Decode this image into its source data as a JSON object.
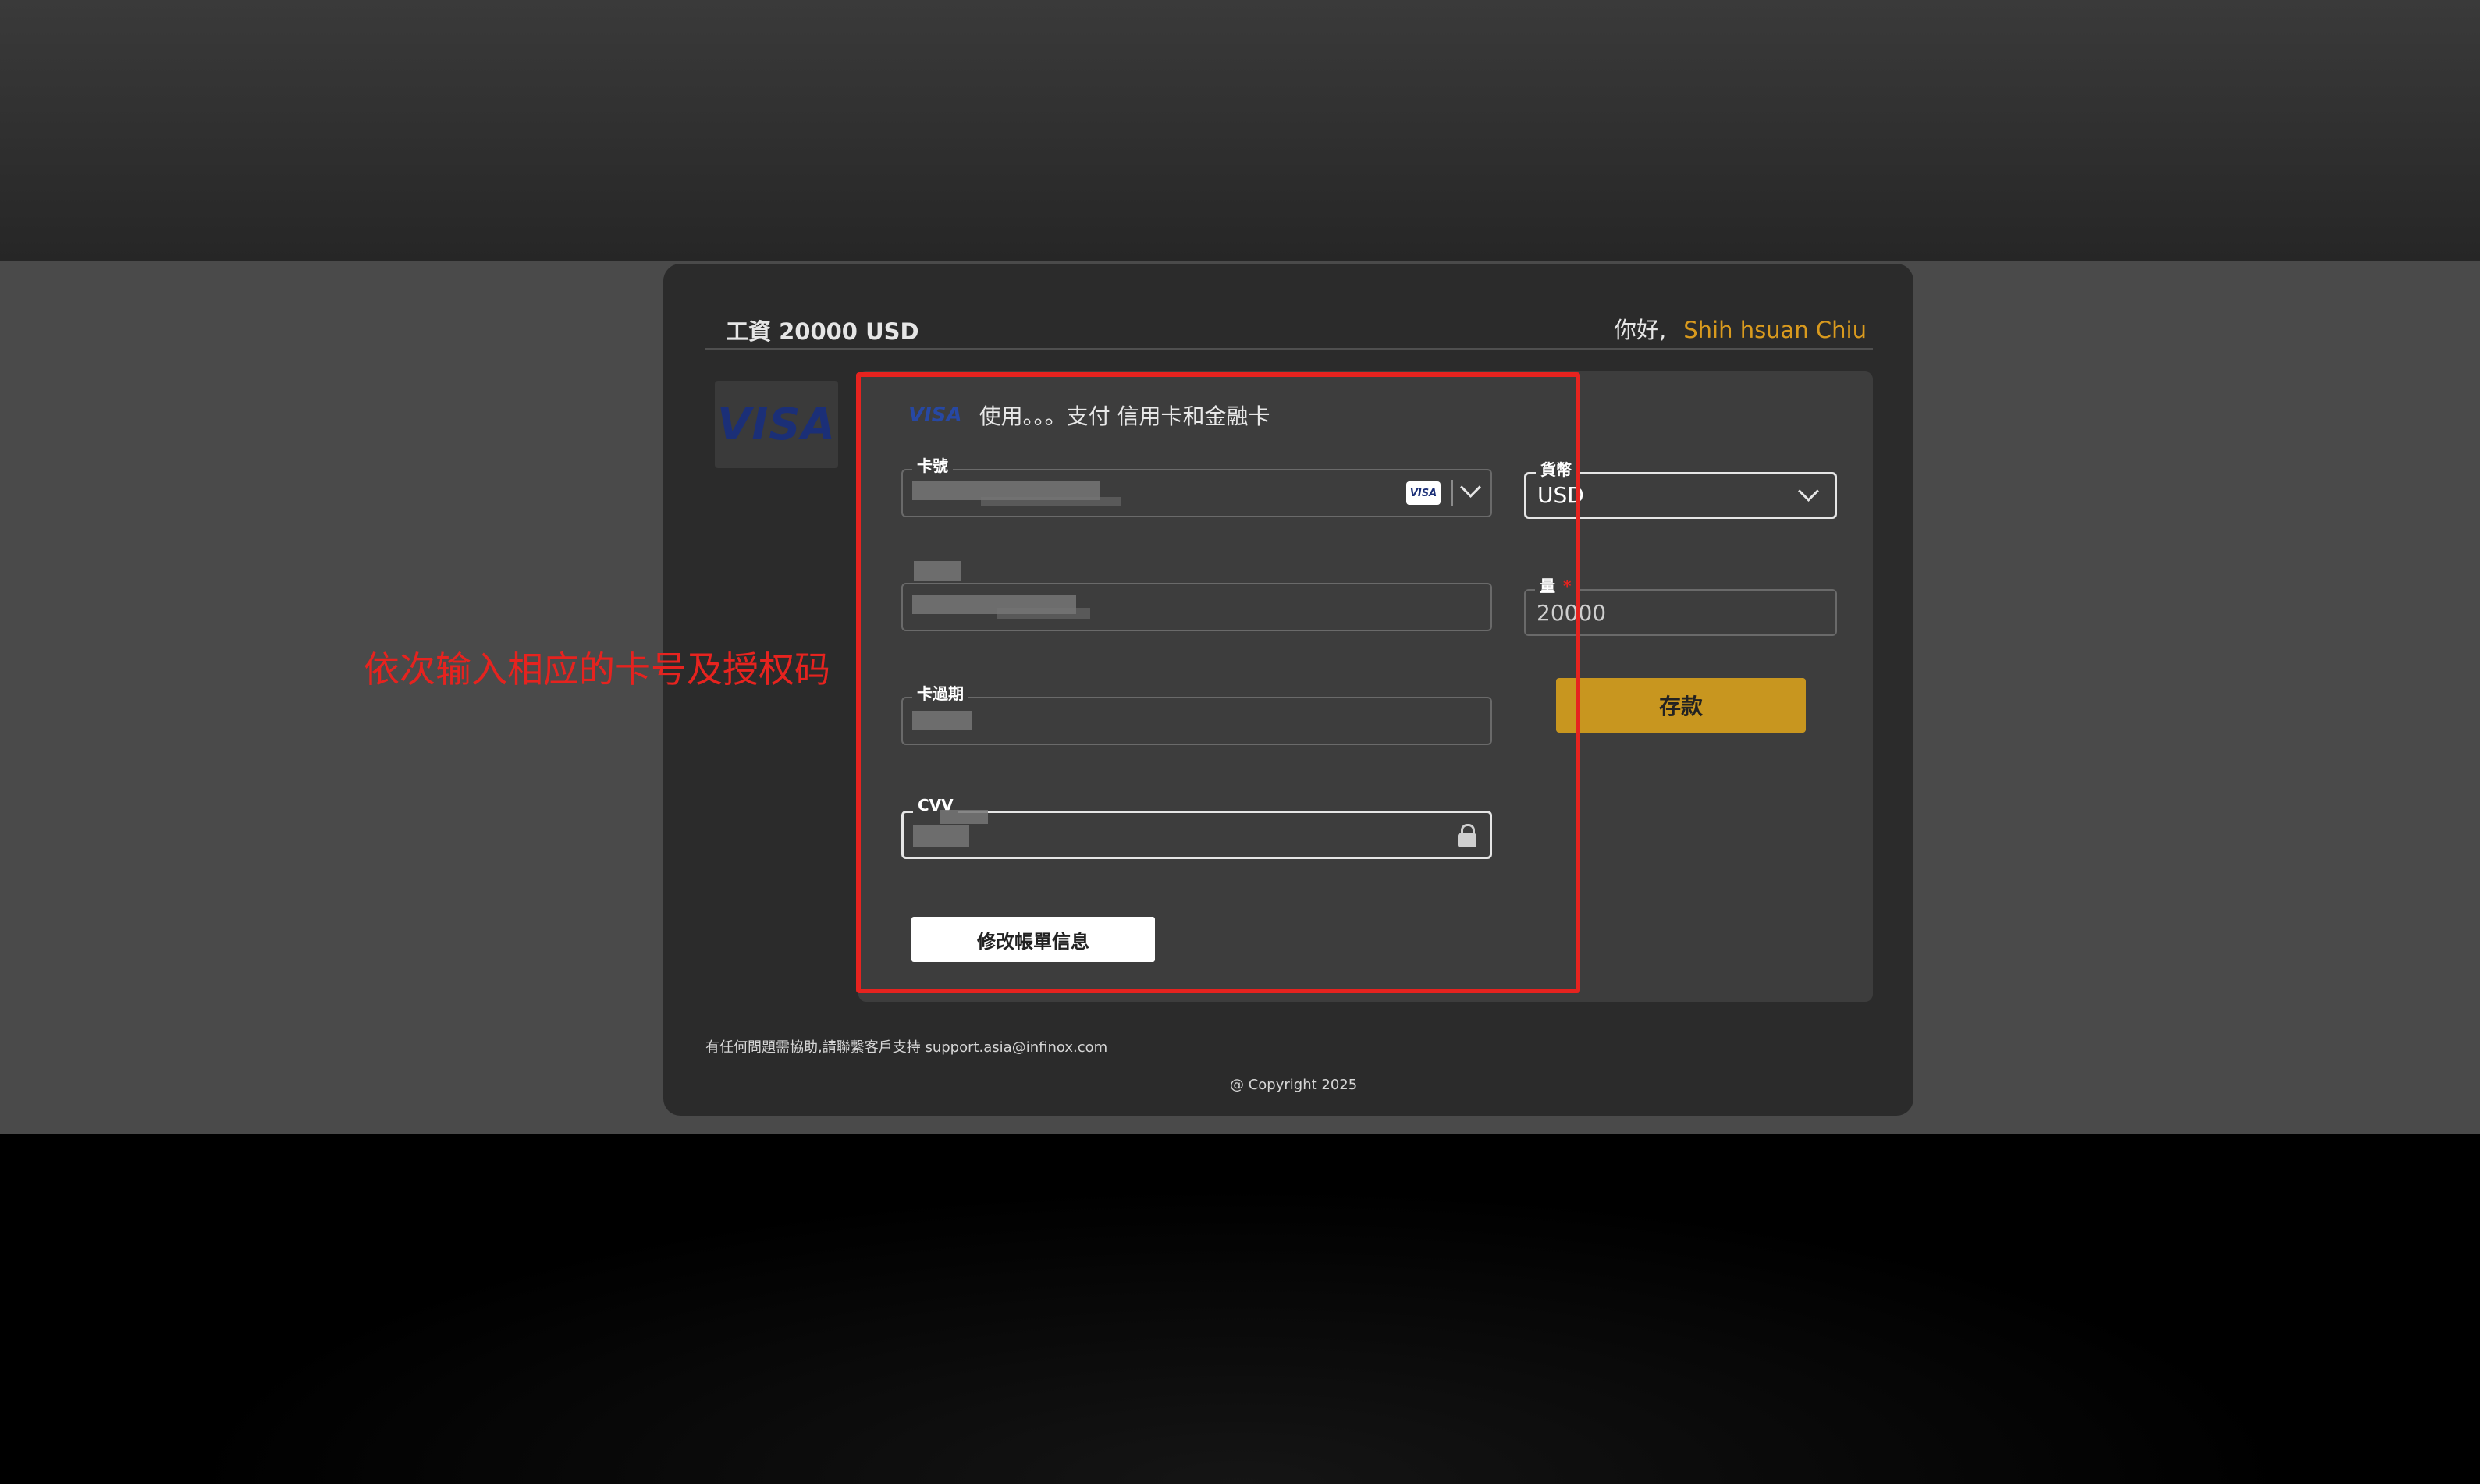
{
  "header": {
    "title": "工資 20000 USD",
    "greeting": "你好,",
    "user_name": "Shih hsuan Chiu"
  },
  "brand": {
    "logo_text": "VISA"
  },
  "payment_method": {
    "icon": "visa-icon",
    "text": "使用。。。支付 信用卡和金融卡"
  },
  "fields": {
    "card_number": {
      "label": "卡號",
      "value": "",
      "badge": "VISA"
    },
    "cardholder": {
      "label": "",
      "value": ""
    },
    "expiry": {
      "label": "卡過期",
      "value": ""
    },
    "cvv": {
      "label": "CVV",
      "value": ""
    },
    "currency": {
      "label": "貨幣",
      "value": "USD"
    },
    "amount": {
      "label": "量",
      "value": "20000",
      "required_mark": "*"
    }
  },
  "buttons": {
    "deposit": "存款",
    "edit_billing": "修改帳單信息"
  },
  "annotation": "依次输入相应的卡号及授权码",
  "footer": {
    "help": "有任何問題需協助,請聯繫客戶支持 support.asia@infinox.com",
    "copyright": "@ Copyright 2025"
  },
  "colors": {
    "accent_gold": "#c8961f",
    "user_name_orange": "#d99a1e",
    "annotation_red": "#e6231f"
  }
}
